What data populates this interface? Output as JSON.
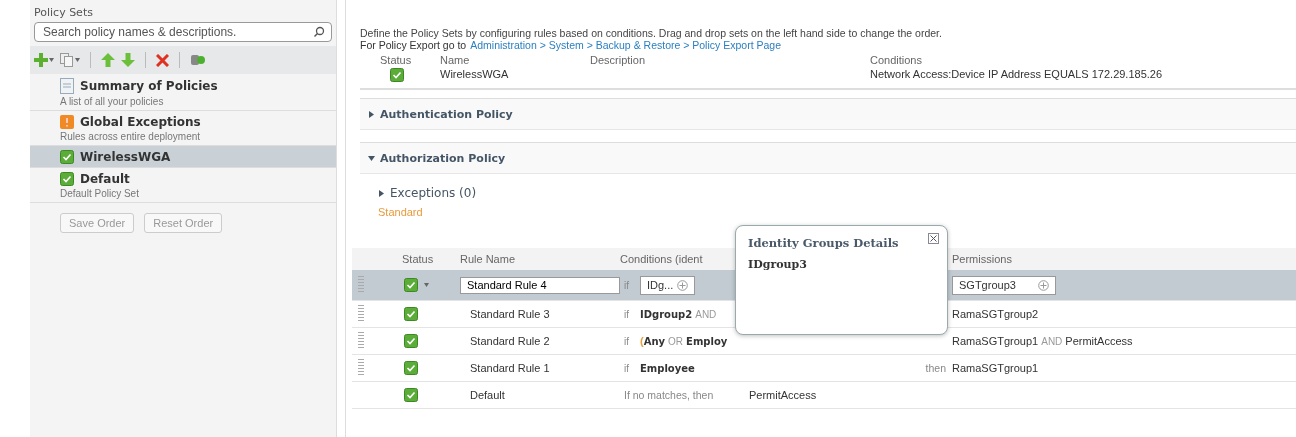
{
  "sidebar": {
    "title": "Policy Sets",
    "search": {
      "placeholder": "Search policy names & descriptions."
    },
    "items": [
      {
        "kind": "summary",
        "name": "Summary of Policies",
        "description": "A list of all your policies",
        "selected": false
      },
      {
        "kind": "exceptions",
        "name": "Global Exceptions",
        "description": "Rules across entire deployment",
        "selected": false
      },
      {
        "kind": "policy",
        "name": "WirelessWGA",
        "enabled": true,
        "selected": true
      },
      {
        "kind": "policy",
        "name": "Default",
        "description": "Default Policy Set",
        "enabled": true,
        "selected": false
      }
    ],
    "buttons": [
      {
        "label": "Save Order",
        "disabled": true
      },
      {
        "label": "Reset Order",
        "disabled": true
      }
    ]
  },
  "intro": "Define the Policy Sets by configuring rules based on conditions. Drag and drop sets on the left hand side to change the order.",
  "export": {
    "label": "For Policy Export go to",
    "link": "Administration > System > Backup & Restore > Policy Export Page"
  },
  "policy_set": {
    "columns": [
      "Status",
      "Name",
      "Description",
      "Conditions"
    ],
    "enabled": true,
    "name": "WirelessWGA",
    "conditions": "Network Access:Device IP Address EQUALS 172.29.185.26"
  },
  "sections": [
    {
      "title": "Authentication Policy",
      "expanded": false
    },
    {
      "title": "Authorization Policy",
      "expanded": true
    }
  ],
  "exceptions": {
    "title": "Exceptions (0)",
    "expanded": false
  },
  "standard_label": "Standard",
  "rules": {
    "columns": [
      "Status",
      "Rule Name",
      "Conditions (ident",
      "Permissions"
    ],
    "rows": [
      {
        "kind": "editing",
        "enabled": true,
        "selected": true,
        "name": "Standard Rule 4",
        "if": "if",
        "condition_token": "IDg...",
        "permission_value": "SGTgroup3"
      },
      {
        "kind": "rule",
        "enabled": true,
        "selected": false,
        "name": "Standard Rule 3",
        "if": "if",
        "conditions": [
          {
            "text": "IDgroup2",
            "kind": "term"
          },
          {
            "text": "AND",
            "kind": "operator"
          }
        ],
        "permissions": [
          {
            "text": "RamaSGTgroup2",
            "kind": "term"
          }
        ]
      },
      {
        "kind": "rule",
        "enabled": true,
        "selected": false,
        "name": "Standard Rule 2",
        "if": "if",
        "conditions": [
          {
            "text": "(",
            "kind": "paren"
          },
          {
            "text": "Any",
            "kind": "term"
          },
          {
            "text": "OR",
            "kind": "operator"
          },
          {
            "text": "Employ",
            "kind": "term"
          }
        ],
        "permissions": [
          {
            "text": "RamaSGTgroup1",
            "kind": "term"
          },
          {
            "text": "AND",
            "kind": "operator"
          },
          {
            "text": "PermitAccess",
            "kind": "term"
          }
        ]
      },
      {
        "kind": "rule",
        "enabled": true,
        "selected": false,
        "name": "Standard Rule 1",
        "if": "if",
        "conditions": [
          {
            "text": "Employee",
            "kind": "term"
          }
        ],
        "then": "then",
        "permissions": [
          {
            "text": "RamaSGTgroup1",
            "kind": "term"
          }
        ]
      },
      {
        "kind": "default",
        "enabled": true,
        "selected": false,
        "name": "Default",
        "fallback": "If no matches, then",
        "permissions": [
          {
            "text": "PermitAccess",
            "kind": "term"
          }
        ]
      }
    ]
  },
  "popover": {
    "title": "Identity Groups Details",
    "value": "IDgroup3"
  }
}
